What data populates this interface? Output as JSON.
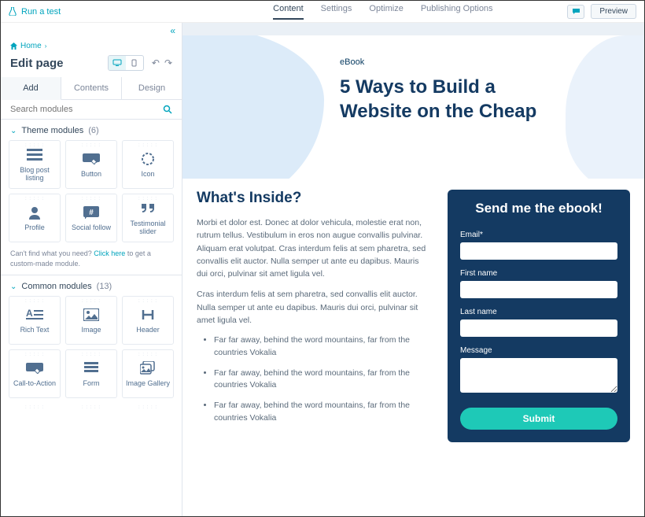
{
  "topbar": {
    "run_test": "Run a test",
    "tabs": [
      "Content",
      "Settings",
      "Optimize",
      "Publishing Options"
    ],
    "active_tab": 0,
    "preview": "Preview"
  },
  "sidebar": {
    "breadcrumb_home": "Home",
    "page_title": "Edit page",
    "subtabs": [
      "Add",
      "Contents",
      "Design"
    ],
    "active_subtab": 0,
    "search_placeholder": "Search modules",
    "helptext_pre": "Can't find what you need? ",
    "helptext_link": "Click here",
    "helptext_post": " to get a custom-made module.",
    "sections": {
      "theme": {
        "label": "Theme modules",
        "count": "(6)",
        "items": [
          {
            "label": "Blog post listing",
            "name": "module-blog-post-listing"
          },
          {
            "label": "Button",
            "name": "module-button"
          },
          {
            "label": "Icon",
            "name": "module-icon"
          },
          {
            "label": "Profile",
            "name": "module-profile"
          },
          {
            "label": "Social follow",
            "name": "module-social-follow"
          },
          {
            "label": "Testimonial slider",
            "name": "module-testimonial-slider"
          }
        ]
      },
      "common": {
        "label": "Common modules",
        "count": "(13)",
        "items": [
          {
            "label": "Rich Text",
            "name": "module-rich-text"
          },
          {
            "label": "Image",
            "name": "module-image"
          },
          {
            "label": "Header",
            "name": "module-header"
          },
          {
            "label": "Call-to-Action",
            "name": "module-cta"
          },
          {
            "label": "Form",
            "name": "module-form"
          },
          {
            "label": "Image Gallery",
            "name": "module-image-gallery"
          }
        ]
      }
    }
  },
  "page": {
    "eyebrow": "eBook",
    "hero_title_l1": "5 Ways to Build a",
    "hero_title_l2": "Website on the Cheap",
    "inside_heading": "What's Inside?",
    "para1": "Morbi et dolor est. Donec at dolor vehicula, molestie erat non, rutrum tellus. Vestibulum in eros non augue convallis pulvinar. Aliquam erat volutpat. Cras interdum felis at sem pharetra, sed convallis elit auctor. Nulla semper ut ante eu dapibus. Mauris dui orci, pulvinar sit amet ligula vel.",
    "para2": "Cras interdum felis at sem pharetra, sed convallis elit auctor. Nulla semper ut ante eu dapibus. Mauris dui orci, pulvinar sit amet ligula vel.",
    "bullets": [
      "Far far away, behind the word mountains, far from the countries Vokalia",
      "Far far away, behind the word mountains, far from the countries Vokalia",
      "Far far away, behind the word mountains, far from the countries Vokalia"
    ],
    "form": {
      "title": "Send me the ebook!",
      "labels": {
        "email": "Email*",
        "first": "First name",
        "last": "Last name",
        "message": "Message"
      },
      "submit": "Submit"
    }
  }
}
